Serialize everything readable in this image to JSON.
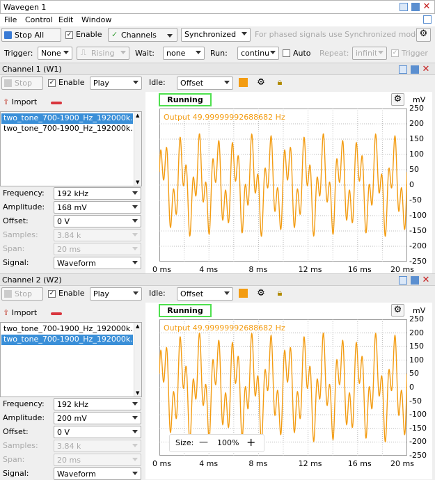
{
  "window": {
    "title": "Wavegen 1"
  },
  "menu": [
    "File",
    "Control",
    "Edit",
    "Window"
  ],
  "toolbar1": {
    "stop_all": "Stop All",
    "enable": "Enable",
    "channels": "Channels",
    "sync_mode": "Synchronized",
    "hint": "For phased signals use Synchronized mode."
  },
  "toolbar2": {
    "trigger_label": "Trigger:",
    "trigger_value": "None",
    "edge_value": "Rising",
    "wait_label": "Wait:",
    "wait_value": "none",
    "run_label": "Run:",
    "run_value": "continu",
    "auto_label": "Auto",
    "repeat_label": "Repeat:",
    "repeat_value": "infinite",
    "trigger_check": "Trigger"
  },
  "channels": [
    {
      "title": "Channel 1 (W1)",
      "stop": "Stop",
      "enable": "Enable",
      "mode": "Play",
      "idle_label": "Idle:",
      "idle_value": "Offset",
      "import": "Import",
      "files": [
        "two_tone_700-1900_Hz_192000k...",
        "two_tone_700-1900_Hz_192000k..."
      ],
      "selected_file": 0,
      "params": [
        {
          "label": "Frequency:",
          "value": "192 kHz",
          "enabled": true
        },
        {
          "label": "Amplitude:",
          "value": "168 mV",
          "enabled": true
        },
        {
          "label": "Offset:",
          "value": "0 V",
          "enabled": true
        },
        {
          "label": "Samples:",
          "value": "3.84 k",
          "enabled": false
        },
        {
          "label": "Span:",
          "value": "20 ms",
          "enabled": false
        },
        {
          "label": "Signal:",
          "value": "Waveform",
          "enabled": true
        }
      ],
      "status": "Running",
      "output_text": "Output 49.99999992688682 Hz",
      "unit": "mV",
      "amplitude_mv": 168
    },
    {
      "title": "Channel 2 (W2)",
      "stop": "Stop",
      "enable": "Enable",
      "mode": "Play",
      "idle_label": "Idle:",
      "idle_value": "Offset",
      "import": "Import",
      "files": [
        "two_tone_700-1900_Hz_192000k...",
        "two_tone_700-1900_Hz_192000k..."
      ],
      "selected_file": 1,
      "params": [
        {
          "label": "Frequency:",
          "value": "192 kHz",
          "enabled": true
        },
        {
          "label": "Amplitude:",
          "value": "200 mV",
          "enabled": true
        },
        {
          "label": "Offset:",
          "value": "0 V",
          "enabled": true
        },
        {
          "label": "Samples:",
          "value": "3.84 k",
          "enabled": false
        },
        {
          "label": "Span:",
          "value": "20 ms",
          "enabled": false
        },
        {
          "label": "Signal:",
          "value": "Waveform",
          "enabled": true
        }
      ],
      "status": "Running",
      "output_text": "Output 49.99999992688682 Hz",
      "unit": "mV",
      "amplitude_mv": 200,
      "size_label": "Size:",
      "size_value": "100%",
      "size_minus": "—",
      "size_plus": "+"
    }
  ],
  "plot": {
    "y_ticks": [
      "250",
      "200",
      "150",
      "100",
      "50",
      "0",
      "-50",
      "-100",
      "-150",
      "-200",
      "-250"
    ],
    "x_ticks": [
      "0 ms",
      "4 ms",
      "8 ms",
      "12 ms",
      "16 ms",
      "20 ms"
    ],
    "y_range_mv": [
      -250,
      250
    ],
    "x_range_ms": [
      0,
      20
    ],
    "wave_color": "#f39c12",
    "tone_hz": [
      700,
      1900
    ],
    "grid": true
  },
  "colors": {
    "accent": "#3a8fd8",
    "running_border": "#4ee04e",
    "idle_square": "#f39c12"
  }
}
